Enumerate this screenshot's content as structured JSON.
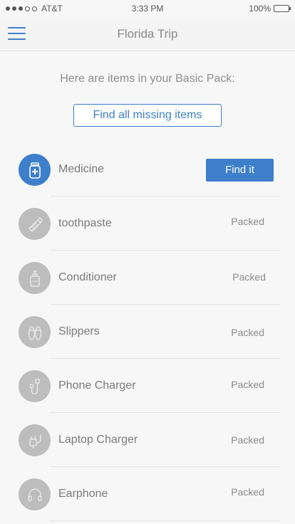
{
  "status_bar": {
    "carrier": "AT&T",
    "time": "3:33 PM",
    "battery": "100%"
  },
  "nav": {
    "title": "Florida Trip"
  },
  "intro_text": "Here are items in your Basic Pack:",
  "find_all_label": "Find all missing items",
  "items": [
    {
      "label": "Medicine",
      "icon": "medicine-bottle-icon",
      "status": "",
      "action": "Find it"
    },
    {
      "label": "toothpaste",
      "icon": "toothpaste-icon",
      "status": "Packed"
    },
    {
      "label": "Conditioner",
      "icon": "conditioner-bottle-icon",
      "status": "Packed"
    },
    {
      "label": "Slippers",
      "icon": "slippers-icon",
      "status": "Packed"
    },
    {
      "label": "Phone Charger",
      "icon": "phone-charger-icon",
      "status": "Packed"
    },
    {
      "label": "Laptop Charger",
      "icon": "laptop-charger-icon",
      "status": "Packed"
    },
    {
      "label": "Earphone",
      "icon": "earphone-icon",
      "status": "Packed"
    }
  ],
  "colors": {
    "accent": "#3d7fca",
    "icon_inactive": "#bdbdbd",
    "background": "#f7f7f7"
  }
}
